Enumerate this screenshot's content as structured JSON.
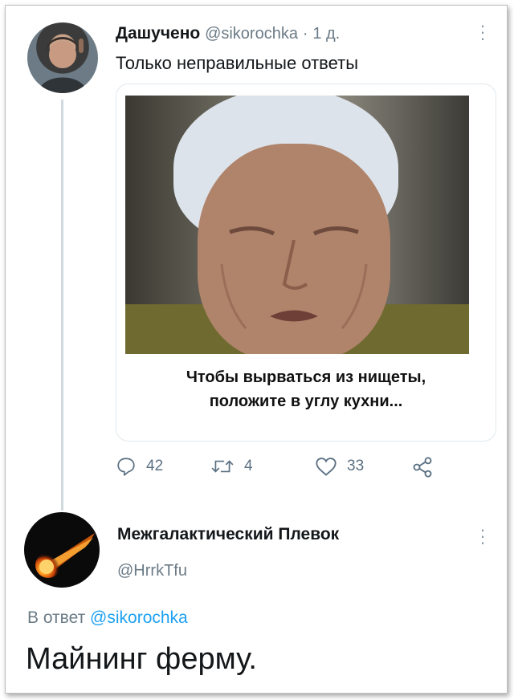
{
  "tweet1": {
    "display_name": "Дашучено",
    "handle": "@sikorochka",
    "separator": "·",
    "time": "1 д.",
    "text": "Только неправильные ответы",
    "card_caption": "Чтобы вырваться из нищеты, положите в углу кухни...",
    "replies": "42",
    "retweets": "4",
    "likes": "33"
  },
  "tweet2": {
    "display_name": "Межгалактический Плевок",
    "handle": "@HrrkTfu",
    "reply_prefix": "В ответ",
    "reply_handle": "@sikorochka",
    "text": "Майнинг ферму."
  },
  "icons": [
    "more-icon",
    "reply-icon",
    "retweet-icon",
    "like-icon",
    "share-icon"
  ],
  "colors": {
    "link": "#1da1f2",
    "muted": "#6b7b86",
    "text": "#14171a"
  }
}
